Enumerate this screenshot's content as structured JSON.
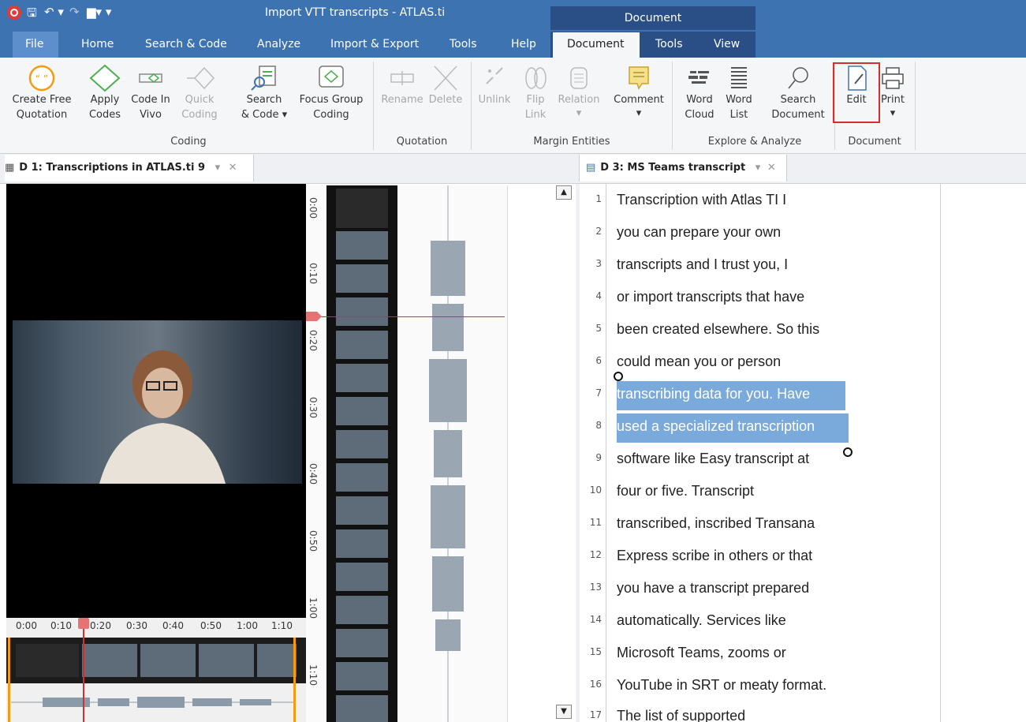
{
  "window": {
    "title": "Import VTT transcripts - ATLAS.ti",
    "context_header": "Document"
  },
  "tabs": [
    "File",
    "Home",
    "Search & Code",
    "Analyze",
    "Import & Export",
    "Tools",
    "Help",
    "Document",
    "Tools",
    "View"
  ],
  "ribbon": {
    "coding": [
      [
        "Create Free",
        "Quotation"
      ],
      [
        "Apply",
        "Codes"
      ],
      [
        "Code In",
        "Vivo"
      ],
      [
        "Quick",
        "Coding"
      ],
      [
        "Search",
        "& Code ▾"
      ],
      [
        "Focus Group",
        "Coding"
      ]
    ],
    "coding_label": "Coding",
    "quotation": [
      "Rename",
      "Delete"
    ],
    "quotation_label": "Quotation",
    "margin": [
      [
        "Unlink",
        ""
      ],
      [
        "Flip",
        "Link"
      ],
      [
        "Relation",
        "▾"
      ],
      [
        "Comment",
        "▾"
      ]
    ],
    "margin_label": "Margin Entities",
    "explore": [
      [
        "Word",
        "Cloud"
      ],
      [
        "Word",
        "List"
      ],
      [
        "Search",
        "Document"
      ]
    ],
    "explore_label": "Explore & Analyze",
    "document": [
      [
        "Edit",
        ""
      ],
      [
        "Print",
        "▾"
      ]
    ],
    "document_label": "Document"
  },
  "doc_tabs": {
    "left": "D 1: Transcriptions in ATLAS.ti 9",
    "right": "D 3: MS Teams transcript"
  },
  "timeline": {
    "labels": [
      "0:00",
      "0:10",
      "0:20",
      "0:30",
      "0:40",
      "0:50",
      "1:00",
      "1:10"
    ]
  },
  "ruler": {
    "labels": [
      "0:00",
      "0:10",
      "0:20",
      "0:30",
      "0:40",
      "0:50",
      "1:00",
      "1:10"
    ]
  },
  "transcript": [
    {
      "n": "1",
      "t": "Transcription with Atlas TI I"
    },
    {
      "n": "2",
      "t": "you can prepare your own"
    },
    {
      "n": "3",
      "t": "transcripts and I trust you, I"
    },
    {
      "n": "4",
      "t": "or import transcripts that have"
    },
    {
      "n": "5",
      "t": "been created elsewhere. So this"
    },
    {
      "n": "6",
      "t": "could mean you or person"
    },
    {
      "n": "7",
      "t": "transcribing data for you. Have"
    },
    {
      "n": "8",
      "t": "used a specialized transcription"
    },
    {
      "n": "9",
      "t": "software like Easy transcript at"
    },
    {
      "n": "10",
      "t": "four or five. Transcript"
    },
    {
      "n": "11",
      "t": "transcribed, inscribed Transana"
    },
    {
      "n": "12",
      "t": "Express scribe in others or that"
    },
    {
      "n": "13",
      "t": "you have a transcript prepared"
    },
    {
      "n": "14",
      "t": "automatically. Services like"
    },
    {
      "n": "15",
      "t": "Microsoft Teams, zooms or"
    },
    {
      "n": "16",
      "t": "YouTube in SRT or meaty format."
    },
    {
      "n": "17",
      "t": "The list of supported"
    }
  ]
}
